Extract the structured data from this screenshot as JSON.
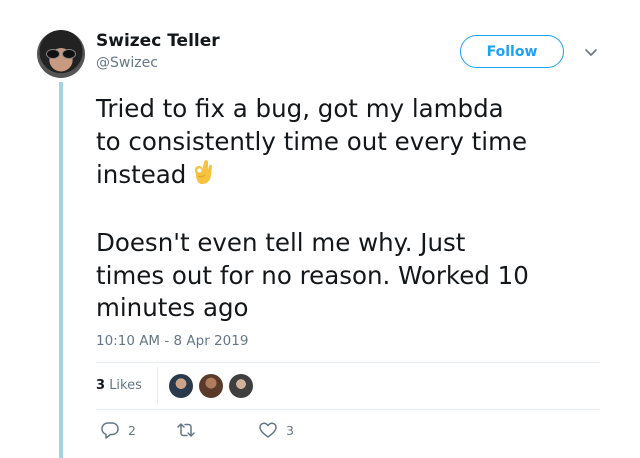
{
  "author": {
    "name": "Swizec Teller",
    "handle": "@Swizec"
  },
  "follow": {
    "label": "Follow"
  },
  "tweet": {
    "line1": "Tried to fix a bug, got my lambda",
    "line2": "to consistently time out every time",
    "line3": "instead",
    "line4": "Doesn't even tell me why. Just",
    "line5": "times out for no reason. Worked 10",
    "line6": "minutes ago"
  },
  "timestamp": "10:10 AM - 8 Apr 2019",
  "likes": {
    "count": "3",
    "label": "Likes"
  },
  "actions": {
    "replies": "2",
    "likes": "3"
  },
  "colors": {
    "accent": "#1da1f2",
    "thread": "#a2d2e5",
    "muted": "#657786"
  },
  "icons": [
    "chevron-down-icon",
    "ok-hand-icon",
    "reply-icon",
    "retweet-icon",
    "heart-icon"
  ]
}
